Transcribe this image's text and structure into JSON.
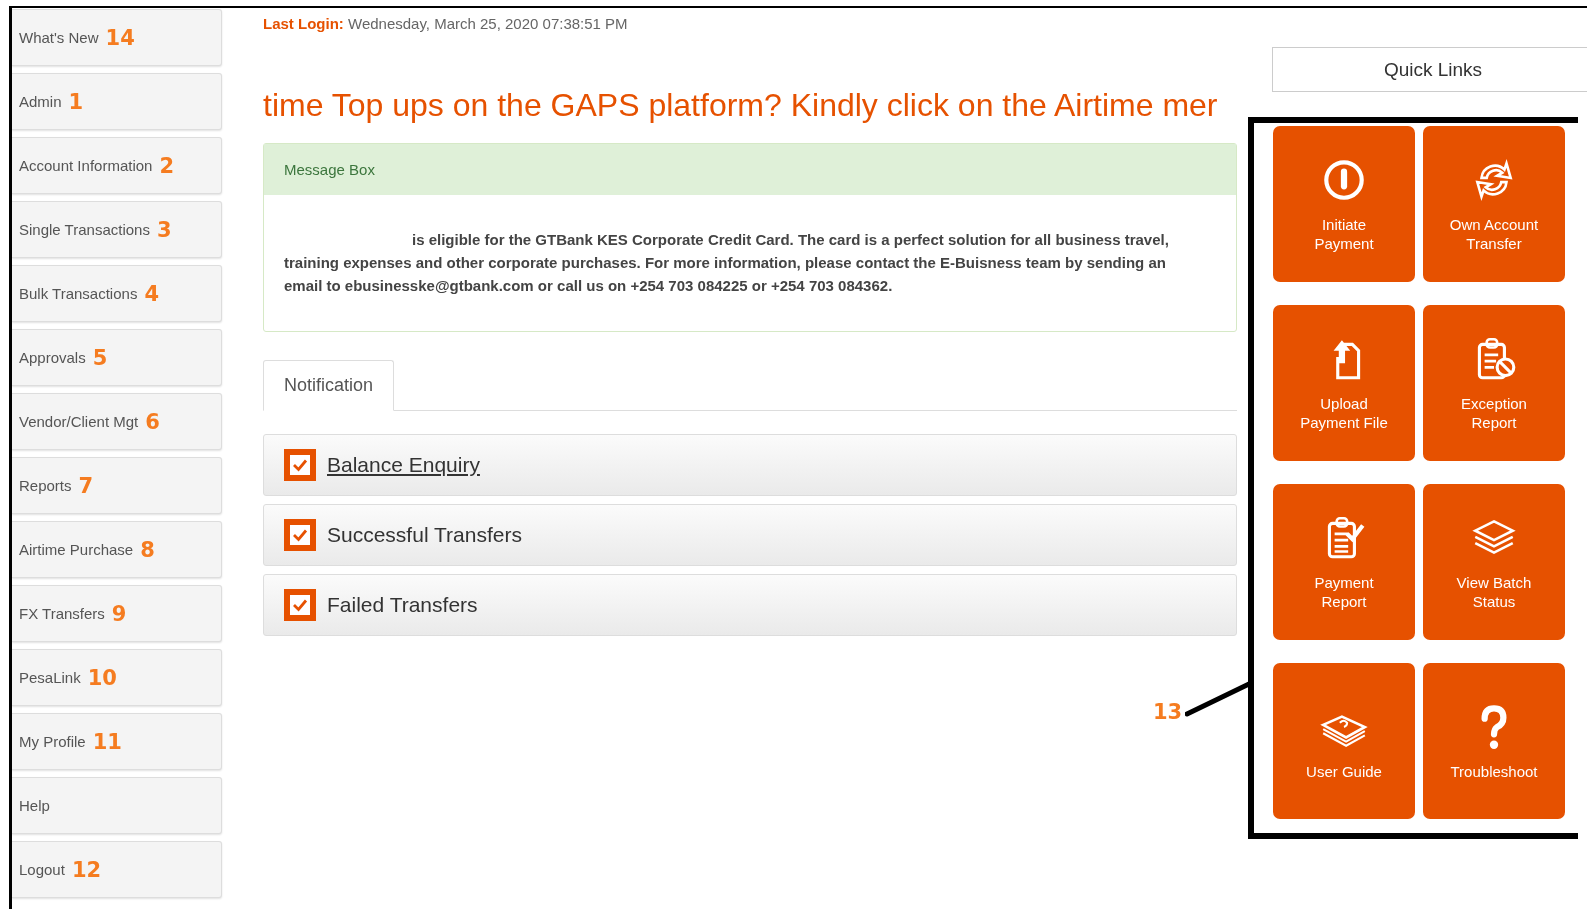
{
  "sidebar": {
    "items": [
      {
        "label": "What's New",
        "badge": "14"
      },
      {
        "label": "Admin",
        "badge": "1"
      },
      {
        "label": "Account Information",
        "badge": "2"
      },
      {
        "label": "Single Transactions",
        "badge": "3"
      },
      {
        "label": "Bulk Transactions",
        "badge": "4"
      },
      {
        "label": "Approvals",
        "badge": "5"
      },
      {
        "label": "Vendor/Client Mgt",
        "badge": "6"
      },
      {
        "label": "Reports",
        "badge": "7"
      },
      {
        "label": "Airtime Purchase",
        "badge": "8"
      },
      {
        "label": "FX Transfers",
        "badge": "9"
      },
      {
        "label": "PesaLink",
        "badge": "10"
      },
      {
        "label": "My Profile",
        "badge": "11"
      },
      {
        "label": "Help"
      },
      {
        "label": "Logout",
        "badge": "12"
      }
    ]
  },
  "last_login": {
    "label": "Last Login:",
    "value": "Wednesday, March 25, 2020 07:38:51 PM"
  },
  "headline": "time Top ups on the GAPS platform? Kindly click on the Airtime mer",
  "message_box": {
    "title": "Message Box",
    "text": "is eligible for the GTBank KES Corporate Credit Card. The card is a perfect solution for all business travel, training expenses and other corporate purchases. For more information, please contact the E-Buisness team by sending an email to ebusinesske@gtbank.com or call us on +254 703 084225 or +254 703 084362."
  },
  "tabs": [
    {
      "label": "Notification",
      "selected": true
    }
  ],
  "notifications": [
    {
      "label": "Balance Enquiry",
      "checked": true,
      "link": true
    },
    {
      "label": "Successful Transfers",
      "checked": true,
      "link": false
    },
    {
      "label": "Failed Transfers",
      "checked": true,
      "link": false
    }
  ],
  "quick_links": {
    "title": "Quick Links",
    "annotation": "13",
    "tiles": [
      {
        "label": "Initiate Payment"
      },
      {
        "label": "Own Account Transfer"
      },
      {
        "label": "Upload Payment File"
      },
      {
        "label": "Exception Report"
      },
      {
        "label": "Payment Report"
      },
      {
        "label": "View Batch Status"
      },
      {
        "label": "User Guide"
      },
      {
        "label": "Troubleshoot"
      }
    ]
  }
}
